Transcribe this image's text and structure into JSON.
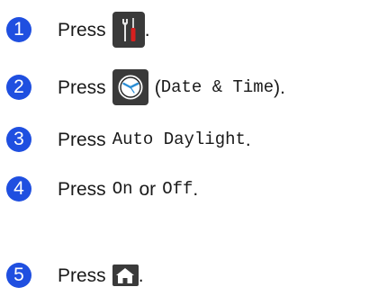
{
  "steps": [
    {
      "number": "1",
      "press": "Press",
      "suffix": "."
    },
    {
      "number": "2",
      "press": "Press",
      "paren_open": "(",
      "option": "Date & Time",
      "paren_close": ").",
      "icon": "clock-icon"
    },
    {
      "number": "3",
      "press": "Press",
      "option": "Auto Daylight",
      "suffix": "."
    },
    {
      "number": "4",
      "press": "Press",
      "option_on": "On",
      "connector": "or",
      "option_off": "Off",
      "suffix": "."
    },
    {
      "number": "5",
      "press": "Press",
      "suffix": "."
    }
  ],
  "icons": {
    "step1": "settings-tools-icon",
    "step2": "date-time-clock-icon",
    "step5": "home-icon"
  },
  "colors": {
    "step_number_bg": "#1f4fe0",
    "tile_bg": "#3a3a3a"
  }
}
